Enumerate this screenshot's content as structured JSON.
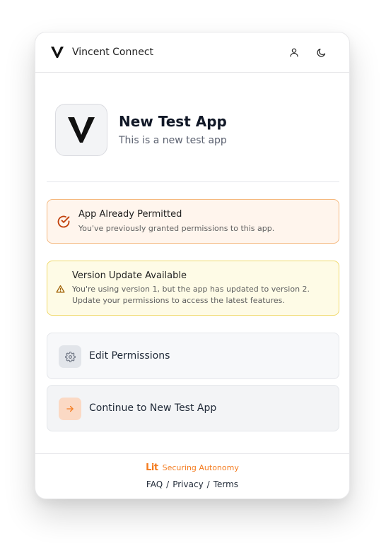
{
  "header": {
    "brand_name": "Vincent Connect",
    "icons": [
      "vincent-logo-icon",
      "user-icon",
      "moon-icon"
    ]
  },
  "app": {
    "name": "New Test App",
    "description": "This is a new test app",
    "logo_icon": "vincent-logo-icon"
  },
  "notices": {
    "permitted": {
      "title": "App Already Permitted",
      "text": "You've previously granted permissions to this app.",
      "icon": "check-circle-icon",
      "accent": "#c2410c"
    },
    "update": {
      "title": "Version Update Available",
      "text": "You're using version 1, but the app has updated to version 2. Update your permissions to access the latest features.",
      "icon": "warning-triangle-icon",
      "accent": "#a16207"
    }
  },
  "actions": {
    "edit": {
      "label": "Edit Permissions",
      "icon": "gear-icon"
    },
    "continue": {
      "label": "Continue to New Test App",
      "icon": "arrow-right-icon",
      "accent": "#f47c20"
    }
  },
  "footer": {
    "brand_logo": "Lit",
    "tagline": "Securing Autonomy",
    "links": {
      "faq": "FAQ",
      "privacy": "Privacy",
      "terms": "Terms",
      "separator": "/"
    }
  }
}
